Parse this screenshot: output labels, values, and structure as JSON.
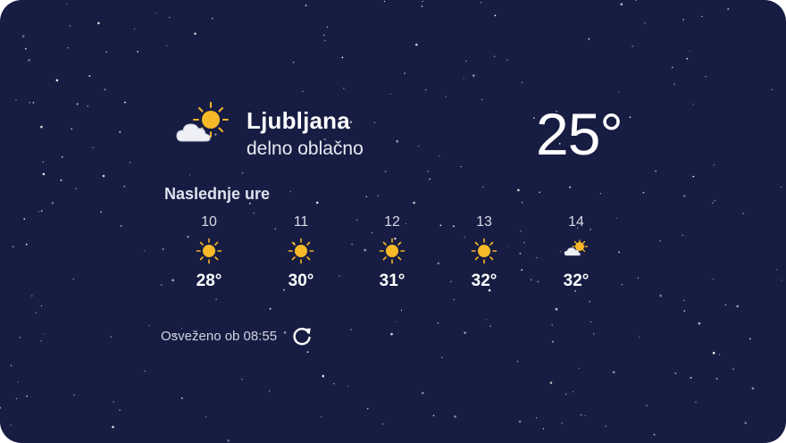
{
  "location": {
    "city": "Ljubljana",
    "condition": "delno oblačno",
    "icon": "partly-cloudy-icon"
  },
  "current": {
    "temperature": "25°"
  },
  "hourly": {
    "title": "Naslednje ure",
    "items": [
      {
        "hour": "10",
        "temp": "28°",
        "icon": "sun-icon"
      },
      {
        "hour": "11",
        "temp": "30°",
        "icon": "sun-icon"
      },
      {
        "hour": "12",
        "temp": "31°",
        "icon": "sun-icon"
      },
      {
        "hour": "13",
        "temp": "32°",
        "icon": "sun-icon"
      },
      {
        "hour": "14",
        "temp": "32°",
        "icon": "partly-cloudy-icon"
      }
    ]
  },
  "footer": {
    "refreshed_text": "Osveženo ob 08:55",
    "refresh_icon": "refresh-icon"
  },
  "colors": {
    "background": "#171d42",
    "sun": "#f7b928",
    "text": "#ffffff"
  }
}
